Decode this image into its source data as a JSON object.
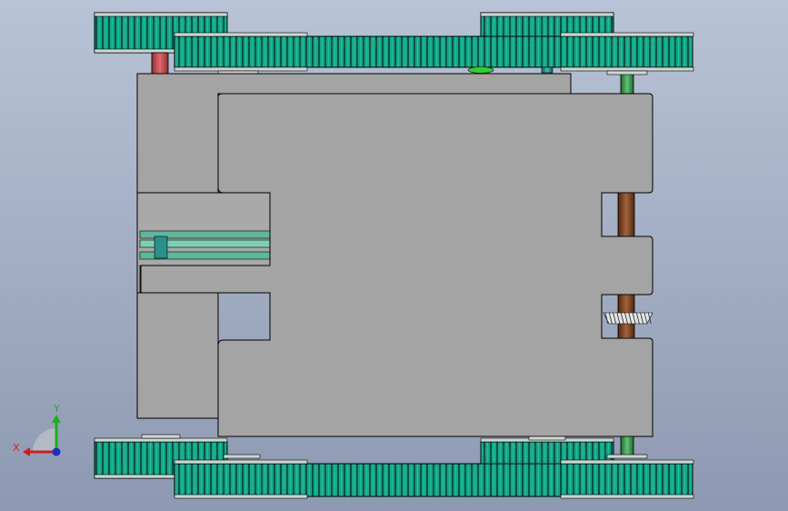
{
  "viewport": {
    "background_top": "#b8c3d6",
    "background_bottom": "#8d99b2"
  },
  "colors": {
    "gear_teeth": "#0fa987",
    "gear_dark": "#0d4f44",
    "gear_rim": "#cfd5d3",
    "body_gray": "#a4a4a4",
    "body_outline": "#000000",
    "shaft_red": "#c4494c",
    "shaft_brown": "#7a4523",
    "shaft_green": "#3f9c55",
    "shaft_teal": "#2b8f8a",
    "rail_green": "#5fb79a",
    "accent_green": "#2fd02f"
  },
  "model": {
    "name": "tracked-chassis-top-view",
    "gear_count": 8,
    "shaft_count": 6
  },
  "triad": {
    "x_label": "X",
    "y_label": "Y",
    "x_color": "#cc1f1f",
    "y_color": "#1fae1f",
    "z_color": "#1a2fd0",
    "icon": "coordinate-triad-icon"
  }
}
